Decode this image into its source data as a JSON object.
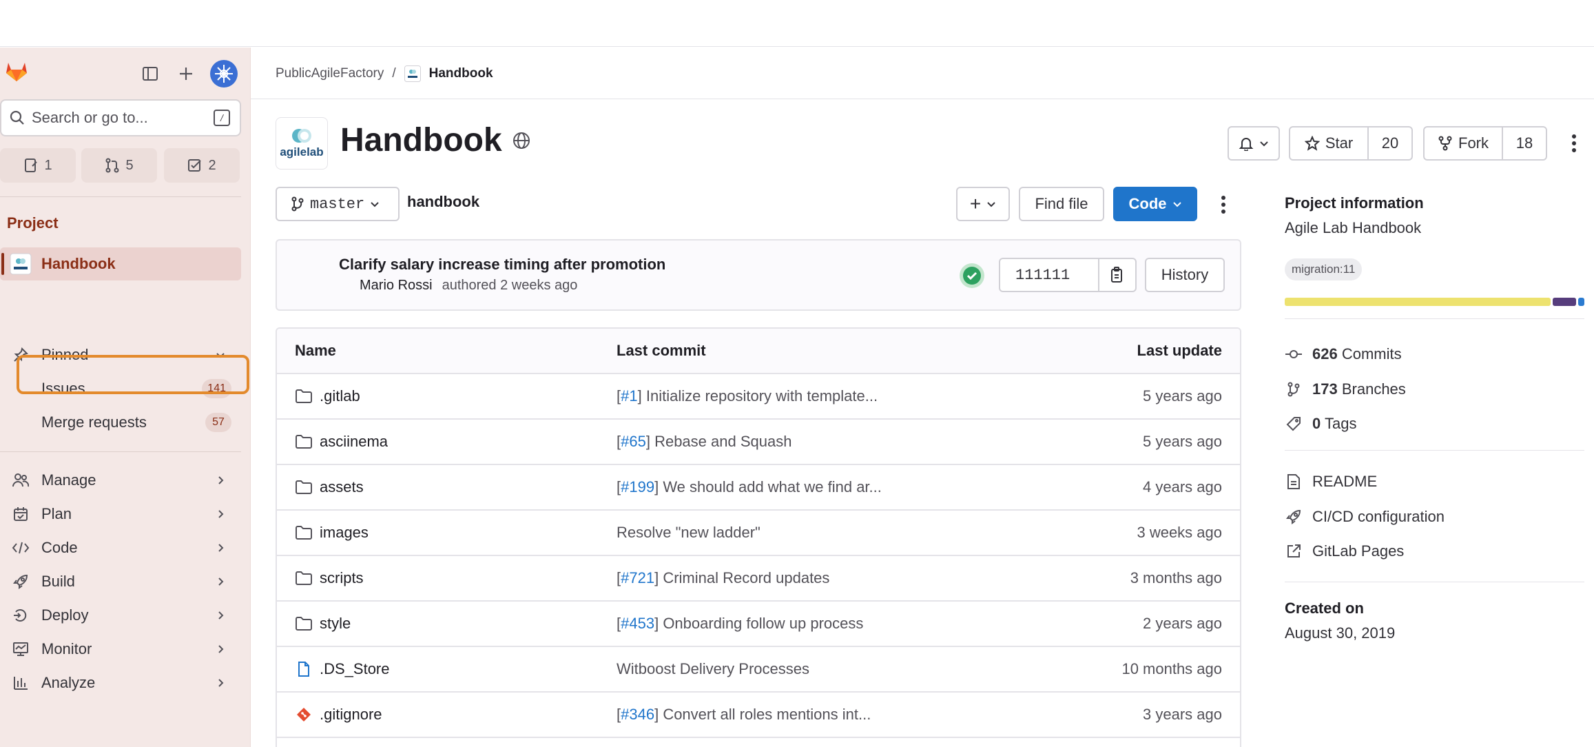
{
  "colors": {
    "sidebar_bg": "#f4e8e6",
    "accent": "#8a2e16",
    "primary_blue": "#1f75cb",
    "highlight": "#e38a2c",
    "success": "#2da160"
  },
  "sidebar": {
    "search_placeholder": "Search or go to...",
    "search_shortcut": "/",
    "counts": {
      "issues": "1",
      "merge_requests": "5",
      "todos": "2"
    },
    "heading": "Project",
    "project_item": "Handbook",
    "pinned_label": "Pinned",
    "pinned_items": [
      {
        "label": "Issues",
        "count": "141"
      },
      {
        "label": "Merge requests",
        "count": "57"
      }
    ],
    "nav": [
      {
        "label": "Manage",
        "icon": "users-icon"
      },
      {
        "label": "Plan",
        "icon": "calendar-icon"
      },
      {
        "label": "Code",
        "icon": "code-icon"
      },
      {
        "label": "Build",
        "icon": "rocket-icon"
      },
      {
        "label": "Deploy",
        "icon": "deploy-icon"
      },
      {
        "label": "Monitor",
        "icon": "monitor-icon"
      },
      {
        "label": "Analyze",
        "icon": "chart-icon"
      }
    ]
  },
  "breadcrumb": {
    "group": "PublicAgileFactory",
    "separator": "/",
    "project": "Handbook"
  },
  "project": {
    "title": "Handbook",
    "avatar_text": "agilelab",
    "star_label": "Star",
    "star_count": "20",
    "fork_label": "Fork",
    "fork_count": "18"
  },
  "repo_toolbar": {
    "branch": "master",
    "path": "handbook",
    "add_label": "+",
    "find_file": "Find file",
    "code": "Code"
  },
  "last_commit": {
    "title": "Clarify salary increase timing after promotion",
    "author": "Mario Rossi",
    "meta": "authored 2 weeks ago",
    "sha": "111111",
    "history": "History"
  },
  "table": {
    "headers": {
      "name": "Name",
      "last_commit": "Last commit",
      "last_update": "Last update"
    },
    "rows": [
      {
        "type": "folder",
        "name": ".gitlab",
        "ref": "#1",
        "msg": "Initialize repository with template...",
        "updated": "5 years ago"
      },
      {
        "type": "folder",
        "name": "asciinema",
        "ref": "#65",
        "msg": "Rebase and Squash",
        "updated": "5 years ago"
      },
      {
        "type": "folder",
        "name": "assets",
        "ref": "#199",
        "msg": "We should add what we find ar...",
        "updated": "4 years ago"
      },
      {
        "type": "folder",
        "name": "images",
        "ref": "",
        "msg": "Resolve \"new ladder\"",
        "updated": "3 weeks ago"
      },
      {
        "type": "folder",
        "name": "scripts",
        "ref": "#721",
        "msg": "Criminal Record updates",
        "updated": "3 months ago"
      },
      {
        "type": "folder",
        "name": "style",
        "ref": "#453",
        "msg": "Onboarding follow up process",
        "updated": "2 years ago"
      },
      {
        "type": "file",
        "name": ".DS_Store",
        "ref": "",
        "msg": "Witboost Delivery Processes",
        "updated": "10 months ago"
      },
      {
        "type": "git",
        "name": ".gitignore",
        "ref": "#346",
        "msg": "Convert all roles mentions int...",
        "updated": "3 years ago"
      }
    ]
  },
  "project_info": {
    "title": "Project information",
    "description": "Agile Lab Handbook",
    "topic": "migration:11",
    "language_bar": [
      {
        "color": "#ede26f",
        "fraction": 0.9
      },
      {
        "color": "#563d7c",
        "fraction": 0.08
      },
      {
        "color": "#2b7bd0",
        "fraction": 0.02
      }
    ],
    "commits_count": "626",
    "commits_label": "Commits",
    "branches_count": "173",
    "branches_label": "Branches",
    "tags_count": "0",
    "tags_label": "Tags",
    "readme": "README",
    "cicd": "CI/CD configuration",
    "pages": "GitLab Pages",
    "created_title": "Created on",
    "created_date": "August 30, 2019"
  }
}
